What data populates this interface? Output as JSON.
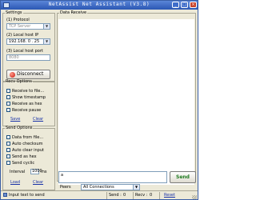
{
  "window": {
    "title": "NetAssist Net Assistant (V3.8)",
    "controls": [
      "_",
      "□",
      "×"
    ]
  },
  "settings": {
    "legend": "Settings",
    "protocol_label": "(1) Protocol",
    "protocol_value": "TCP Server",
    "host_label": "(2) Local host IP",
    "host_value": "192.168. 0 . 25",
    "port_label": "(3) Local host port",
    "port_value": "8080",
    "disconnect_label": "Disconnect"
  },
  "recv_options": {
    "legend": "Recv Options",
    "items": [
      "Receive to file...",
      "Show timestamp",
      "Receive as hex",
      "Receive pause"
    ],
    "save_label": "Save",
    "clear_label": "Clear"
  },
  "send_options": {
    "legend": "Send Options",
    "items": [
      "Data from file...",
      "Auto checksum",
      "Auto clear input",
      "Send as hex",
      "Send cyclic"
    ],
    "interval_label": "Interval",
    "interval_value": "1000",
    "interval_unit": "ms",
    "load_label": "Load",
    "clear_label": "Clear"
  },
  "receive": {
    "legend": "Data Receive"
  },
  "send": {
    "peers_label": "Peers",
    "peers_value": "All Connections",
    "input_value": "a",
    "send_label": "Send"
  },
  "status": {
    "hint": "Input text to send",
    "send_label": "Send :",
    "send_count": "0",
    "recv_label": "Recv :",
    "recv_count": "0",
    "reset_label": "Reset"
  },
  "colors": {
    "titlebar": "#2b57b3",
    "disconnect_dot": "#c8140b",
    "send_text": "#1f7a1f",
    "link": "#1a33a8"
  }
}
